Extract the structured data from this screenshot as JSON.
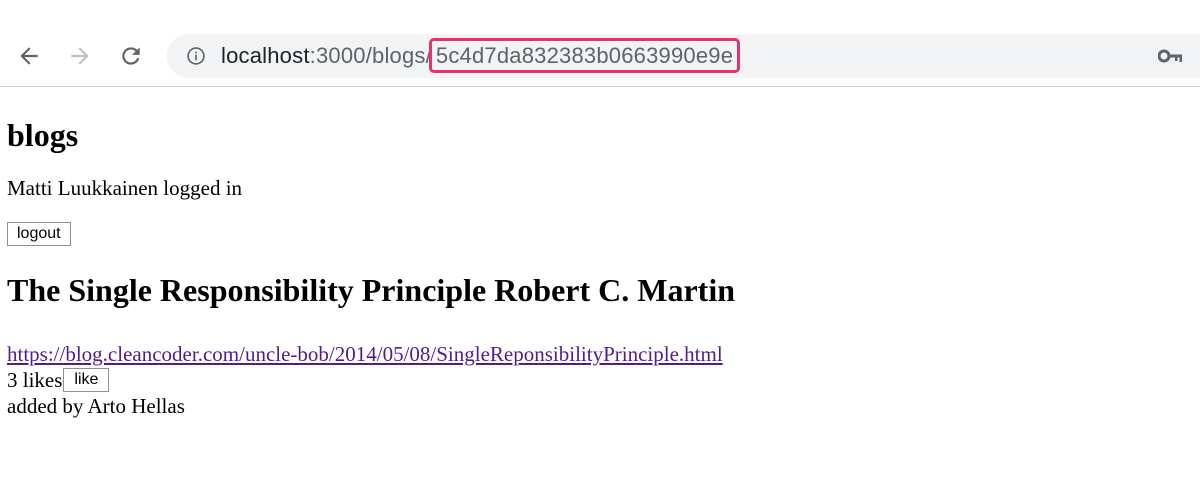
{
  "browser": {
    "url_host": "localhost",
    "url_path": ":3000/blogs/",
    "url_id": "5c4d7da832383b0663990e9e",
    "highlight_color": "#e8316f",
    "icons": {
      "back": "arrow-left-icon",
      "forward": "arrow-right-icon",
      "reload": "reload-icon",
      "info": "info-icon",
      "key": "key-icon"
    }
  },
  "page": {
    "heading": "blogs",
    "logged_in_text": "Matti Luukkainen logged in",
    "logout_label": "logout"
  },
  "blog": {
    "title": "The Single Responsibility Principle Robert C. Martin",
    "url": "https://blog.cleancoder.com/uncle-bob/2014/05/08/SingleReponsibilityPrinciple.html",
    "likes_text": "3 likes",
    "like_label": "like",
    "added_by": "added by Arto Hellas",
    "link_color": "#551a8b"
  }
}
